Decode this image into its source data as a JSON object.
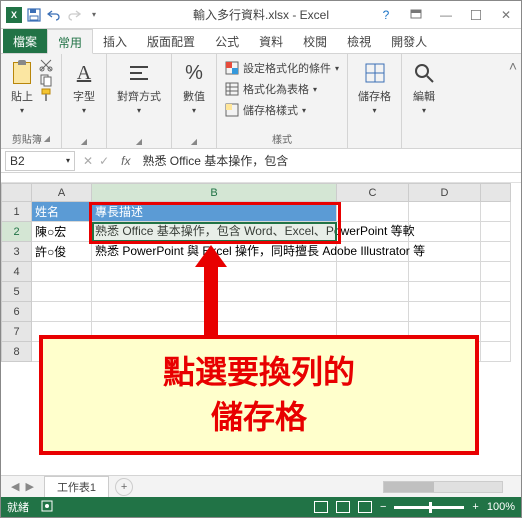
{
  "title": {
    "filename": "輸入多行資料.xlsx",
    "app": "Excel"
  },
  "tabs": {
    "file": "檔案",
    "home": "常用",
    "insert": "插入",
    "layout": "版面配置",
    "formulas": "公式",
    "data": "資料",
    "review": "校閱",
    "view": "檢視",
    "dev": "開發人"
  },
  "ribbon": {
    "clipboard": {
      "paste": "貼上",
      "label": "剪貼簿"
    },
    "font": {
      "btn": "字型"
    },
    "align": {
      "btn": "對齊方式"
    },
    "number": {
      "btn": "數值",
      "sym": "%"
    },
    "styles": {
      "cond": "設定格式化的條件",
      "table": "格式化為表格",
      "cellstyle": "儲存格樣式",
      "label": "樣式"
    },
    "cells": {
      "btn": "儲存格"
    },
    "editing": {
      "btn": "編輯"
    }
  },
  "address": {
    "cell": "B2",
    "formula": "熟悉 Office 基本操作，包含"
  },
  "columns": [
    "A",
    "B",
    "C",
    "D"
  ],
  "rows": [
    "1",
    "2",
    "3",
    "4",
    "5",
    "6",
    "7",
    "8"
  ],
  "headers": {
    "a1": "姓名",
    "b1": "專長描述"
  },
  "data_rows": {
    "a2": "陳○宏",
    "b2": "熟悉 Office 基本操作，包含 Word、Excel、PowerPoint 等軟",
    "a3": "許○俊",
    "b3": "熟悉 PowerPoint 與 Excel 操作，同時擅長 Adobe Illustrator 等"
  },
  "callout": {
    "line1": "點選要換列的",
    "line2": "儲存格"
  },
  "sheet": {
    "name": "工作表1"
  },
  "status": {
    "ready": "就緒",
    "rec": "",
    "zoom": "100%"
  }
}
